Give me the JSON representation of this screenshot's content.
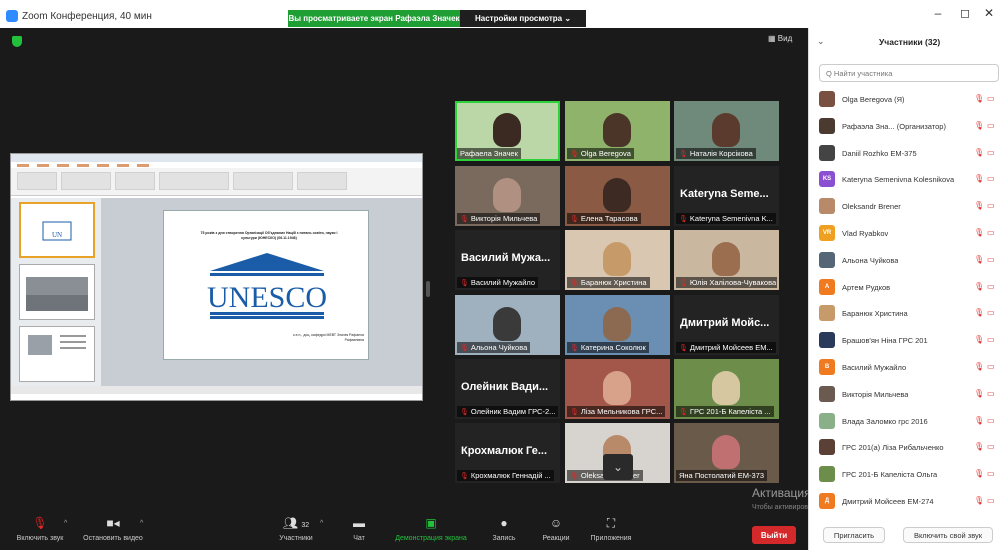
{
  "app": {
    "title": "Zoom Конференция, 40 мин"
  },
  "banner": {
    "sharing": "Вы просматриваете экран Рафаэла Значек",
    "view_options": "Настройки просмотра ⌄"
  },
  "main": {
    "view_label": "Вид"
  },
  "slide": {
    "heading": "75 років з дня створення Організації Об'єднаних Націй з питань освіти, науки і культури (ЮНЕСКО) (06.11.1946)",
    "logo_text": "UNESCO",
    "footer": "к.е.н., доц. кафедри МЕВТ Значек Рафаела Рафаелівна"
  },
  "tiles": [
    {
      "name": "Рафаела Значек",
      "big": "",
      "mic_off": false,
      "speaking": true,
      "bg": "#bcd7a7",
      "face": "#3a2a22"
    },
    {
      "name": "Olga Beregova",
      "big": "",
      "mic_off": true,
      "speaking": false,
      "bg": "#8fb36b",
      "face": "#4a3528"
    },
    {
      "name": "Наталія Корсікова",
      "big": "",
      "mic_off": true,
      "speaking": false,
      "bg": "#6f8a7a",
      "face": "#5b3b2e"
    },
    {
      "name": "Викторія Мильчева",
      "big": "",
      "mic_off": true,
      "speaking": false,
      "bg": "#7a6a5d",
      "face": "#b09080"
    },
    {
      "name": "Елена Тарасова",
      "big": "",
      "mic_off": true,
      "speaking": false,
      "bg": "#8a5a44",
      "face": "#3d2a22"
    },
    {
      "name": "Kateryna Semenivna K...",
      "big": "Kateryna Seme...",
      "mic_off": true,
      "speaking": false,
      "bg": "#232323",
      "face": ""
    },
    {
      "name": "Василий Мужайло",
      "big": "Василий Мужа...",
      "mic_off": true,
      "speaking": false,
      "bg": "#232323",
      "face": ""
    },
    {
      "name": "Баранюк Христина",
      "big": "",
      "mic_off": true,
      "speaking": false,
      "bg": "#d9c7b1",
      "face": "#c79a6a"
    },
    {
      "name": "Юлія Халілова-Чувакова",
      "big": "",
      "mic_off": true,
      "speaking": false,
      "bg": "#c9b79f",
      "face": "#9a6e4e"
    },
    {
      "name": "Альона Чуйкова",
      "big": "",
      "mic_off": true,
      "speaking": false,
      "bg": "#9fb0bf",
      "face": "#3a3a3a"
    },
    {
      "name": "Катерина Соколюк",
      "big": "",
      "mic_off": true,
      "speaking": false,
      "bg": "#6a8fb3",
      "face": "#8c6a52"
    },
    {
      "name": "Дмитрий Мойсеев ЕМ...",
      "big": "Дмитрий Мойс...",
      "mic_off": true,
      "speaking": false,
      "bg": "#232323",
      "face": ""
    },
    {
      "name": "Олейник Вадим ГРС-2...",
      "big": "Олейник Вади...",
      "mic_off": true,
      "speaking": false,
      "bg": "#232323",
      "face": ""
    },
    {
      "name": "Ліза Мельникова ГРС...",
      "big": "",
      "mic_off": true,
      "speaking": false,
      "bg": "#a3574a",
      "face": "#d8a28a"
    },
    {
      "name": "ГРС 201-Б Капеліста ...",
      "big": "",
      "mic_off": true,
      "speaking": false,
      "bg": "#6d8e4b",
      "face": "#d6c7a0"
    },
    {
      "name": "Крохмалюк Геннадій ...",
      "big": "Крохмалюк Ге...",
      "mic_off": true,
      "speaking": false,
      "bg": "#232323",
      "face": ""
    },
    {
      "name": "Oleksandr Brener",
      "big": "",
      "mic_off": true,
      "speaking": false,
      "bg": "#d7d4cf",
      "face": "#b88a6a"
    },
    {
      "name": "Яна Постолатий ЕМ-373",
      "big": "",
      "mic_off": false,
      "speaking": false,
      "bg": "#6a5a4a",
      "face": "#c07070"
    }
  ],
  "panel": {
    "title": "Участники (32)",
    "search_placeholder": "Q Найти участника",
    "participants": [
      {
        "name": "Olga Beregova (Я)",
        "initials": "",
        "color": "#7a5040"
      },
      {
        "name": "Рафаэла Зна... (Организатор)",
        "initials": "",
        "color": "#4a3a30"
      },
      {
        "name": "Daniil Rozhko ЕМ-375",
        "initials": "",
        "color": "#444444"
      },
      {
        "name": "Kateryna Semenivna Kolesnikova",
        "initials": "KS",
        "color": "#8b4fd1"
      },
      {
        "name": "Oleksandr Brener",
        "initials": "",
        "color": "#b88a6a"
      },
      {
        "name": "Vlad Ryabkov",
        "initials": "VR",
        "color": "#f0a020"
      },
      {
        "name": "Альона Чуйкова",
        "initials": "",
        "color": "#556677"
      },
      {
        "name": "Артем Рудков",
        "initials": "A",
        "color": "#f07a20"
      },
      {
        "name": "Баранюк Христина",
        "initials": "",
        "color": "#c79a6a"
      },
      {
        "name": "Брашов'ян Ніна ГРС 201",
        "initials": "",
        "color": "#2a3a5a"
      },
      {
        "name": "Василий Мужайло",
        "initials": "В",
        "color": "#f07a20"
      },
      {
        "name": "Викторія Мильчева",
        "initials": "",
        "color": "#6a5a50"
      },
      {
        "name": "Влада Заломко грс 2016",
        "initials": "",
        "color": "#8ab08a"
      },
      {
        "name": "ГРС 201(а) Ліза Рибальченко",
        "initials": "",
        "color": "#5a4035"
      },
      {
        "name": "ГРС 201-Б Капеліста Ольга",
        "initials": "",
        "color": "#6d8e4b"
      },
      {
        "name": "Дмитрий Мойсеев ЕМ-274",
        "initials": "Д",
        "color": "#f07a20"
      }
    ],
    "invite": "Пригласить",
    "unmute": "Включить свой звук"
  },
  "watermark": {
    "title": "Активация Windows",
    "sub": "Чтобы активировать Windows, перейдите в раздел \"Параметры\"."
  },
  "toolbar": {
    "audio": "Включить звук",
    "video": "Остановить видео",
    "participants": "Участники",
    "participants_count": "32",
    "chat": "Чат",
    "share": "Демонстрация экрана",
    "record": "Запись",
    "reactions": "Реакции",
    "apps": "Приложения",
    "leave": "Выйти"
  }
}
